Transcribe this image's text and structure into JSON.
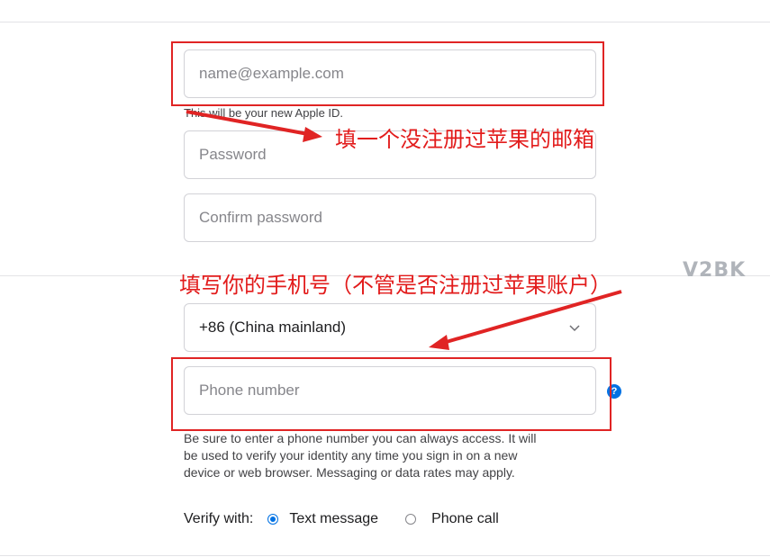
{
  "form": {
    "email_placeholder": "name@example.com",
    "email_hint": "This will be your new Apple ID.",
    "password_placeholder": "Password",
    "confirm_placeholder": "Confirm password",
    "country_value": "+86 (China mainland)",
    "phone_placeholder": "Phone number",
    "help_glyph": "?",
    "phone_hint_lines": [
      "Be sure to enter a phone number you can always access. It will",
      "be used to verify your identity any time you sign in on a new",
      "device or web browser. Messaging or data rates may apply."
    ],
    "verify_label": "Verify with:",
    "verify_options": [
      {
        "label": "Text message",
        "selected": true
      },
      {
        "label": "Phone call",
        "selected": false
      }
    ]
  },
  "annotations": {
    "email_note": "填一个没注册过苹果的邮箱",
    "phone_note": "填写你的手机号（不管是否注册过苹果账户）",
    "annotation_color": "#e21b1b"
  },
  "watermark": "V2BK",
  "colors": {
    "accent": "#0071e3",
    "border": "#d2d2d7",
    "highlight": "#e02424"
  },
  "icons": {
    "country_dropdown": "chevron-down-icon",
    "help": "question-icon"
  }
}
